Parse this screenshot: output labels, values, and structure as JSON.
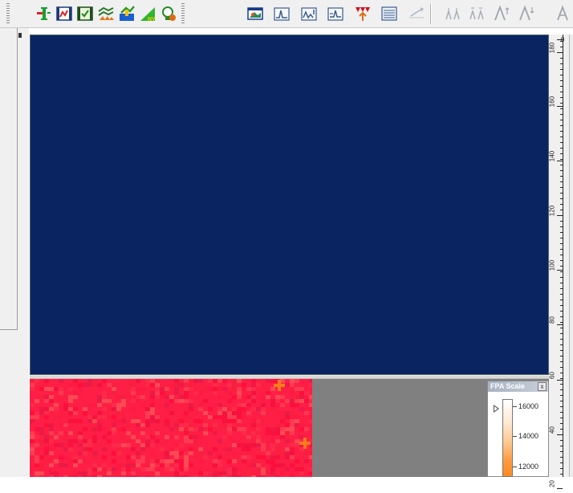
{
  "toolbar": {
    "buttons": [
      {
        "icon": "probe-icon"
      },
      {
        "icon": "filmstrip-red-icon"
      },
      {
        "icon": "filmstrip-check-icon"
      },
      {
        "icon": "terrain-layers-icon"
      },
      {
        "icon": "focus-chart-icon"
      },
      {
        "icon": "ny-triangle-icon"
      },
      {
        "icon": "lightbulb-icon"
      },
      {
        "icon": "image-view-icon"
      },
      {
        "icon": "spectrum-a-icon"
      },
      {
        "icon": "spectrum-b-icon"
      },
      {
        "icon": "spectrum-c-icon"
      },
      {
        "icon": "peaks-arrow-icon"
      },
      {
        "icon": "table-lines-icon"
      },
      {
        "icon": "trend-line-icon"
      },
      {
        "icon": "peak-pair-a-icon"
      },
      {
        "icon": "peak-pair-b-icon"
      },
      {
        "icon": "lambda-arrow-a-icon"
      },
      {
        "icon": "lambda-arrow-b-icon"
      },
      {
        "icon": "lambda-cut-icon"
      }
    ]
  },
  "colors": {
    "main_view": "#0a2462",
    "heatmap_base": "#ff1e46",
    "gray_area": "#808080",
    "marker": "#ff7a1a"
  },
  "fpa": {
    "title": "FPA Scale",
    "close": "x",
    "labels": [
      "16000",
      "14000",
      "12000"
    ]
  },
  "ruler": {
    "labels": [
      "0",
      "180",
      "160",
      "140",
      "120",
      "100",
      "80",
      "60",
      "40",
      "20"
    ]
  }
}
